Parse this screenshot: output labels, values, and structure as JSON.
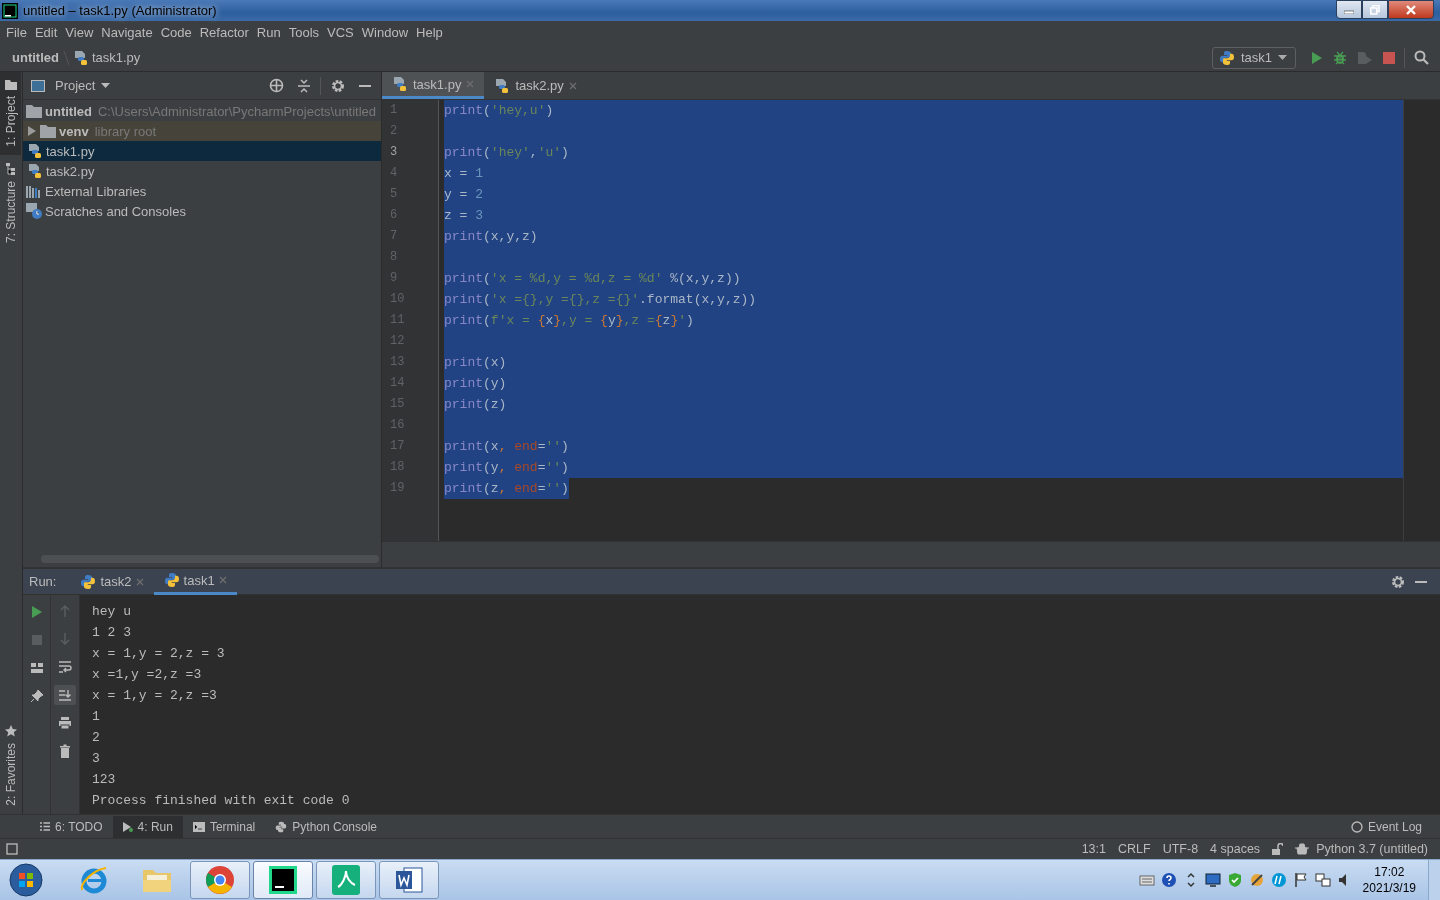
{
  "window": {
    "title": "untitled – task1.py (Administrator)"
  },
  "menu": [
    "File",
    "Edit",
    "View",
    "Navigate",
    "Code",
    "Refactor",
    "Run",
    "Tools",
    "VCS",
    "Window",
    "Help"
  ],
  "breadcrumbs": [
    {
      "text": "untitled",
      "kind": "project"
    },
    {
      "text": "task1.py",
      "kind": "file"
    }
  ],
  "run_config": {
    "name": "task1"
  },
  "left_tabs_top": [
    {
      "label": "1: Project",
      "selected": true
    },
    {
      "label": "7: Structure",
      "selected": false
    }
  ],
  "left_tabs_bottom": [
    {
      "label": "2: Favorites",
      "selected": false
    }
  ],
  "project": {
    "title": "Project",
    "tree": [
      {
        "label": "untitled",
        "detail": "C:\\Users\\Administrator\\PycharmProjects\\untitled",
        "kind": "project",
        "selected": false,
        "children": [
          {
            "label": "venv",
            "detail": "library root",
            "kind": "library",
            "expanded": false,
            "selected": false
          },
          {
            "label": "task1.py",
            "kind": "python",
            "selected": true
          },
          {
            "label": "task2.py",
            "kind": "python",
            "selected": false
          }
        ]
      },
      {
        "label": "External Libraries",
        "kind": "libraries",
        "selected": false
      },
      {
        "label": "Scratches and Consoles",
        "kind": "scratches",
        "selected": false
      }
    ]
  },
  "editor": {
    "tabs": [
      {
        "label": "task1.py",
        "selected": true
      },
      {
        "label": "task2.py",
        "selected": false
      }
    ],
    "lines": [
      {
        "number": "1",
        "current": false,
        "selected": true,
        "selection_to_eol": true,
        "tokens": [
          {
            "text": "print",
            "kind": "builtin"
          },
          {
            "text": "(",
            "kind": "plain"
          },
          {
            "text": "'hey,u'",
            "kind": "string"
          },
          {
            "text": ")",
            "kind": "plain"
          }
        ]
      },
      {
        "number": "2",
        "current": false,
        "selected": true,
        "selection_to_eol": true
      },
      {
        "number": "3",
        "current": true,
        "selected": true,
        "selection_to_eol": true,
        "tokens": [
          {
            "text": "print",
            "kind": "builtin"
          },
          {
            "text": "(",
            "kind": "plain"
          },
          {
            "text": "'hey'",
            "kind": "string"
          },
          {
            "text": ",",
            "kind": "plain"
          },
          {
            "text": "'u'",
            "kind": "string"
          },
          {
            "text": ")",
            "kind": "plain"
          }
        ]
      },
      {
        "number": "4",
        "current": false,
        "selected": true,
        "selection_to_eol": true,
        "tokens": [
          {
            "text": "x = ",
            "kind": "plain"
          },
          {
            "text": "1",
            "kind": "number"
          }
        ]
      },
      {
        "number": "5",
        "current": false,
        "selected": true,
        "selection_to_eol": true,
        "tokens": [
          {
            "text": "y = ",
            "kind": "plain"
          },
          {
            "text": "2",
            "kind": "number"
          }
        ]
      },
      {
        "number": "6",
        "current": false,
        "selected": true,
        "selection_to_eol": true,
        "tokens": [
          {
            "text": "z = ",
            "kind": "plain"
          },
          {
            "text": "3",
            "kind": "number"
          }
        ]
      },
      {
        "number": "7",
        "current": false,
        "selected": true,
        "selection_to_eol": true,
        "tokens": [
          {
            "text": "print",
            "kind": "builtin"
          },
          {
            "text": "(x,y,z)",
            "kind": "plain"
          }
        ]
      },
      {
        "number": "8",
        "current": false,
        "selected": true,
        "selection_to_eol": true
      },
      {
        "number": "9",
        "current": false,
        "selected": true,
        "selection_to_eol": true,
        "tokens": [
          {
            "text": "print",
            "kind": "builtin"
          },
          {
            "text": "(",
            "kind": "plain"
          },
          {
            "text": "'x = %d,y = %d,z = %d'",
            "kind": "string"
          },
          {
            "text": " %(x,y,z))",
            "kind": "plain"
          }
        ]
      },
      {
        "number": "10",
        "current": false,
        "selected": true,
        "selection_to_eol": true,
        "tokens": [
          {
            "text": "print",
            "kind": "builtin"
          },
          {
            "text": "(",
            "kind": "plain"
          },
          {
            "text": "'x ={},y ={},z ={}'",
            "kind": "string"
          },
          {
            "text": ".format(x,y,z))",
            "kind": "plain"
          }
        ]
      },
      {
        "number": "11",
        "current": false,
        "selected": true,
        "selection_to_eol": true,
        "tokens": [
          {
            "text": "print",
            "kind": "builtin"
          },
          {
            "text": "(",
            "kind": "plain"
          },
          {
            "text": "f'x = ",
            "kind": "string"
          },
          {
            "text": "{",
            "kind": "brace"
          },
          {
            "text": "x",
            "kind": "plain"
          },
          {
            "text": "}",
            "kind": "brace"
          },
          {
            "text": ",y = ",
            "kind": "string"
          },
          {
            "text": "{",
            "kind": "brace"
          },
          {
            "text": "y",
            "kind": "plain"
          },
          {
            "text": "}",
            "kind": "brace"
          },
          {
            "text": ",z =",
            "kind": "string"
          },
          {
            "text": "{",
            "kind": "brace"
          },
          {
            "text": "z",
            "kind": "plain"
          },
          {
            "text": "}",
            "kind": "brace"
          },
          {
            "text": "'",
            "kind": "string"
          },
          {
            "text": ")",
            "kind": "plain"
          }
        ]
      },
      {
        "number": "12",
        "current": false,
        "selected": true,
        "selection_to_eol": true
      },
      {
        "number": "13",
        "current": false,
        "selected": true,
        "selection_to_eol": true,
        "tokens": [
          {
            "text": "print",
            "kind": "builtin"
          },
          {
            "text": "(x)",
            "kind": "plain"
          }
        ]
      },
      {
        "number": "14",
        "current": false,
        "selected": true,
        "selection_to_eol": true,
        "tokens": [
          {
            "text": "print",
            "kind": "builtin"
          },
          {
            "text": "(y)",
            "kind": "plain"
          }
        ]
      },
      {
        "number": "15",
        "current": false,
        "selected": true,
        "selection_to_eol": true,
        "tokens": [
          {
            "text": "print",
            "kind": "builtin"
          },
          {
            "text": "(z)",
            "kind": "plain"
          }
        ]
      },
      {
        "number": "16",
        "current": false,
        "selected": true,
        "selection_to_eol": true
      },
      {
        "number": "17",
        "current": false,
        "selected": true,
        "selection_to_eol": true,
        "tokens": [
          {
            "text": "print",
            "kind": "builtin"
          },
          {
            "text": "(x",
            "kind": "plain"
          },
          {
            "text": ", ",
            "kind": "comma"
          },
          {
            "text": "end",
            "kind": "param"
          },
          {
            "text": "=",
            "kind": "plain"
          },
          {
            "text": "''",
            "kind": "string"
          },
          {
            "text": ")",
            "kind": "plain"
          }
        ]
      },
      {
        "number": "18",
        "current": false,
        "selected": true,
        "selection_to_eol": true,
        "tokens": [
          {
            "text": "print",
            "kind": "builtin"
          },
          {
            "text": "(y",
            "kind": "plain"
          },
          {
            "text": ", ",
            "kind": "comma"
          },
          {
            "text": "end",
            "kind": "param"
          },
          {
            "text": "=",
            "kind": "plain"
          },
          {
            "text": "''",
            "kind": "string"
          },
          {
            "text": ")",
            "kind": "plain"
          }
        ]
      },
      {
        "number": "19",
        "current": false,
        "selected": true,
        "selection_to_eol": false,
        "tokens": [
          {
            "text": "print",
            "kind": "builtin"
          },
          {
            "text": "(z",
            "kind": "plain"
          },
          {
            "text": ", ",
            "kind": "comma"
          },
          {
            "text": "end",
            "kind": "param"
          },
          {
            "text": "=",
            "kind": "plain"
          },
          {
            "text": "''",
            "kind": "string"
          },
          {
            "text": ")",
            "kind": "plain"
          }
        ]
      }
    ]
  },
  "run": {
    "label": "Run:",
    "tabs": [
      {
        "label": "task2",
        "selected": false
      },
      {
        "label": "task1",
        "selected": true
      }
    ],
    "output": [
      "hey u",
      "1 2 3",
      "x = 1,y = 2,z = 3",
      "x =1,y =2,z =3",
      "x = 1,y = 2,z =3",
      "1",
      "2",
      "3",
      "123",
      "Process finished with exit code 0"
    ]
  },
  "tool_tabs": [
    {
      "label": "6: TODO",
      "kind": "todo",
      "selected": false
    },
    {
      "label": "4: Run",
      "kind": "run",
      "selected": true
    },
    {
      "label": "Terminal",
      "kind": "terminal",
      "selected": false
    },
    {
      "label": "Python Console",
      "kind": "console",
      "selected": false
    }
  ],
  "event_log": "Event Log",
  "status_bar": {
    "items": [
      "13:1",
      "CRLF",
      "UTF-8",
      "4 spaces"
    ],
    "interpreter": "Python 3.7 (untitled)"
  },
  "taskbar": {
    "apps": [
      {
        "kind": "ie",
        "open": false,
        "active": false
      },
      {
        "kind": "explorer",
        "open": false,
        "active": false
      },
      {
        "kind": "chrome",
        "open": true,
        "active": false
      },
      {
        "kind": "pycharm",
        "open": true,
        "active": true
      },
      {
        "kind": "pdf",
        "open": true,
        "active": false
      },
      {
        "kind": "word",
        "open": true,
        "active": false
      }
    ],
    "time": "17:02",
    "date": "2021/3/19"
  }
}
